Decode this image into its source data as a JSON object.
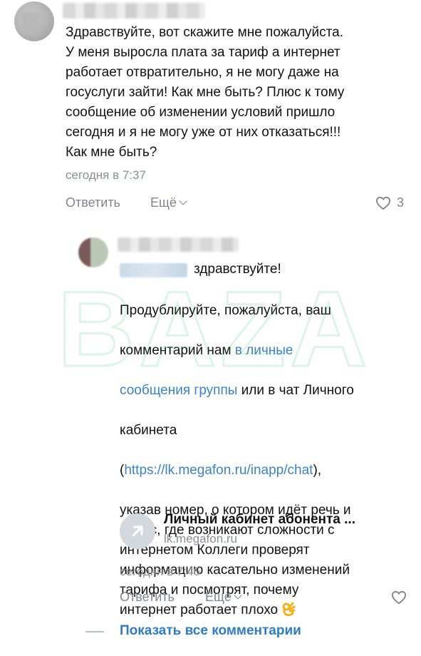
{
  "comment1": {
    "text": "Здравствуйте, вот скажите мне пожалуйста.\nУ меня выросла плата за тариф а интернет\nработает отвратительно, я не могу даже на\nгосуслуги зайти! Как мне быть? Плюс к тому\nсообщение об изменении условий пришло\nсегодня и я не могу уже от них отказаться!!!\nКак мне быть?",
    "time": "сегодня в 7:37",
    "reply_label": "Ответить",
    "more_label": "Ещё",
    "likes": "3"
  },
  "reply": {
    "greeting": "здравствуйте!",
    "line1": "Продублируйте, пожалуйста, ваш",
    "line2_pre": "комментарий нам ",
    "line2_link": "в личные",
    "line3_link": "сообщения группы",
    "line3_post": " или в чат Личного",
    "line4": "кабинета",
    "line5_pre": "(",
    "line5_link": "https://lk.megafon.ru/inapp/chat",
    "line5_post": "),",
    "rest": "указав номер, о котором идёт речь и\nадрес, где возникают сложности с\nинтернетом Коллеги проверят\nинформацию касательно изменений\nтарифа и посмотрят, почему\nинтернет работает плохо",
    "link_card": {
      "title": "Личный кабинет абонента ...",
      "url": "lk.megafon.ru"
    },
    "time": "сегодня в 7:46",
    "reply_label": "Ответить",
    "more_label": "Ещё"
  },
  "footer": {
    "show_all_label": "Показать все комментарии"
  },
  "watermark": {
    "text": "BAZA"
  },
  "colors": {
    "link": "#3b83c8",
    "show_all": "#2f7bc4",
    "muted": "#7c8590",
    "watermark": "#22c55e"
  },
  "icons": [
    "heart-icon",
    "chevron-down-icon",
    "external-link-arrow-icon",
    "ok-hand-emoji-icon"
  ]
}
